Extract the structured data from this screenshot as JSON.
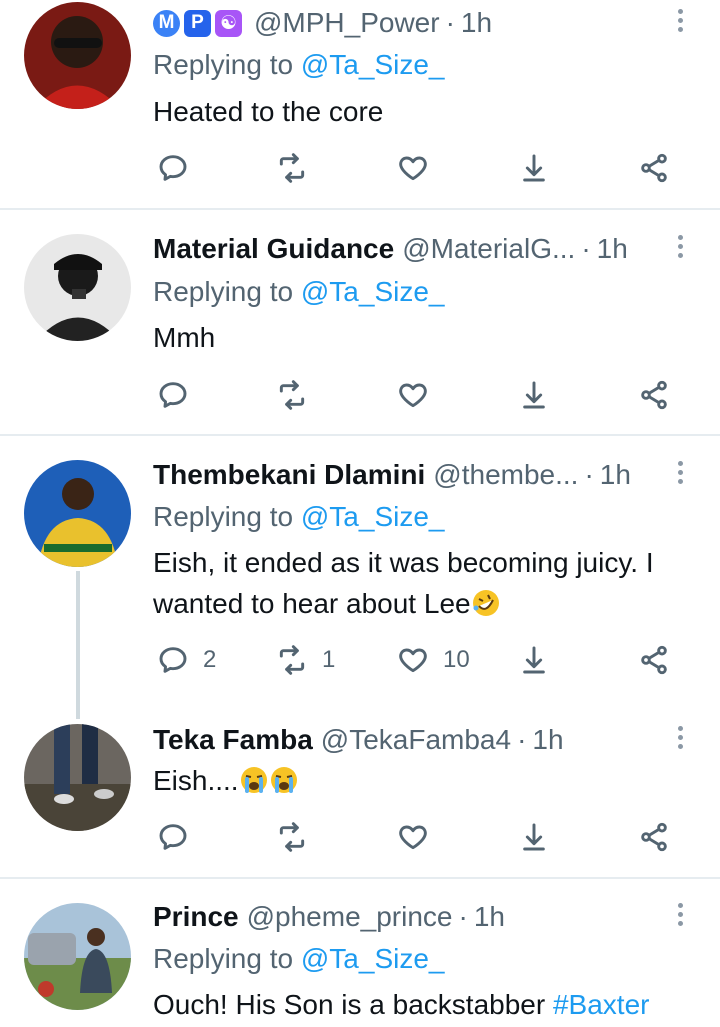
{
  "colors": {
    "accent": "#1d9bf0",
    "muted": "#536471",
    "divider": "#e6ecf0"
  },
  "tweets": [
    {
      "name": "",
      "badges": [
        "M",
        "P",
        "☯"
      ],
      "handle": "@MPH_Power",
      "time": "1h",
      "replying_prefix": "Replying to",
      "replying_to": "@Ta_Size_",
      "text": "Heated to the core",
      "counts": {
        "reply": "",
        "retweet": "",
        "like": ""
      }
    },
    {
      "name": "Material Guidance",
      "handle": "@MaterialG...",
      "time": "1h",
      "replying_prefix": "Replying to",
      "replying_to": "@Ta_Size_",
      "text": "Mmh",
      "counts": {
        "reply": "",
        "retweet": "",
        "like": ""
      }
    },
    {
      "name": "Thembekani Dlamini",
      "handle": "@thembe...",
      "time": "1h",
      "replying_prefix": "Replying to",
      "replying_to": "@Ta_Size_",
      "text_line1": "Eish, it ended as it was becoming juicy. I",
      "text_line2": "wanted to hear about Lee",
      "text_emoji": "rolling-on-floor-laughing",
      "counts": {
        "reply": "2",
        "retweet": "1",
        "like": "10"
      }
    },
    {
      "name": "Teka Famba",
      "handle": "@TekaFamba4",
      "time": "1h",
      "text": "Eish....",
      "text_emojis": [
        "loudly-crying-face",
        "loudly-crying-face"
      ],
      "counts": {
        "reply": "",
        "retweet": "",
        "like": ""
      }
    },
    {
      "name": "Prince",
      "handle": "@pheme_prince",
      "time": "1h",
      "replying_prefix": "Replying to",
      "replying_to": "@Ta_Size_",
      "text": "Ouch! His Son is a backstabber",
      "hashtag": "#Baxter"
    }
  ],
  "icons": {
    "reply": "reply-icon",
    "retweet": "retweet-icon",
    "like": "heart-icon",
    "bookmark": "download-arrow-icon",
    "share": "share-icon",
    "more": "more-vertical-icon"
  }
}
